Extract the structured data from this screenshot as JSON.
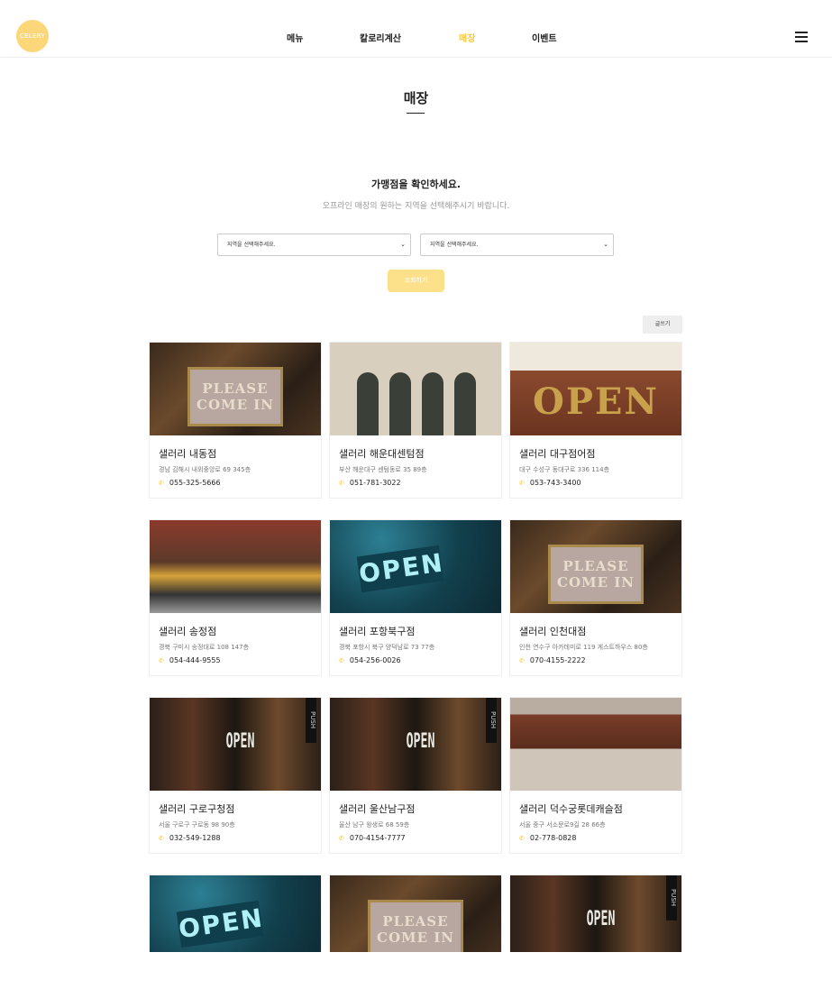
{
  "header": {
    "logo_text": "CELERY",
    "nav": [
      {
        "label": "메뉴",
        "active": false
      },
      {
        "label": "칼로리계산",
        "active": false
      },
      {
        "label": "매장",
        "active": true
      },
      {
        "label": "이벤트",
        "active": false
      }
    ],
    "menu_icon": "hamburger-icon"
  },
  "page": {
    "title": "매장",
    "heading": "가맹점을 확인하세요.",
    "subheading": "오프라인 매장의 원하는 지역을 선택해주시기 바랍니다."
  },
  "filters": {
    "region1_selected": "지역을 선택해주세요.",
    "region2_selected": "지역을 선택해주세요.",
    "search_label": "조회하기"
  },
  "write_label": "글쓰기",
  "accent_color": "#f5c842",
  "stores": [
    {
      "name": "샐러리 내동점",
      "address": "경남 김해시 내외중앙로 69 345층",
      "phone": "055-325-5666",
      "photo": "please-come-in-sign"
    },
    {
      "name": "샐러리 해운대센텀점",
      "address": "부산 해운대구 센텀동로 35 89층",
      "phone": "051-781-3022",
      "photo": "arched-storefront"
    },
    {
      "name": "샐러리 대구점어점",
      "address": "대구 수성구 동대구로 336 114층",
      "phone": "053-743-3400",
      "photo": "open-brick-sign"
    },
    {
      "name": "샐러리 송정점",
      "address": "경북 구미시 송정대로 108 147층",
      "phone": "054-444-9555",
      "photo": "street-shops"
    },
    {
      "name": "샐러리 포항북구점",
      "address": "경북 포항시 북구 양덕남로 73 77층",
      "phone": "054-256-0026",
      "photo": "open-blue-sign"
    },
    {
      "name": "샐러리 인천대점",
      "address": "인천 연수구 아카데미로 119 게스트하우스 80층",
      "phone": "070-4155-2222",
      "photo": "please-come-in-sign"
    },
    {
      "name": "샐러리 구로구청점",
      "address": "서울 구로구 구로동 98 90층",
      "phone": "032-549-1288",
      "photo": "open-door-push"
    },
    {
      "name": "샐러리 울산남구점",
      "address": "울산 남구 왕생로 68 59층",
      "phone": "070-4154-7777",
      "photo": "open-door-push"
    },
    {
      "name": "샐러리 덕수궁롯데캐슬점",
      "address": "서울 중구 서소문로9길 28 66층",
      "phone": "02-778-0828",
      "photo": "storefront-shop"
    },
    {
      "name": "",
      "address": "",
      "phone": "",
      "photo": "open-blue-sign"
    },
    {
      "name": "",
      "address": "",
      "phone": "",
      "photo": "please-come-in-sign"
    },
    {
      "name": "",
      "address": "",
      "phone": "",
      "photo": "open-door-push"
    }
  ],
  "sign_text": {
    "please": "PLEASE",
    "come_in": "COME IN",
    "open": "OPEN",
    "push": "PUSH"
  }
}
